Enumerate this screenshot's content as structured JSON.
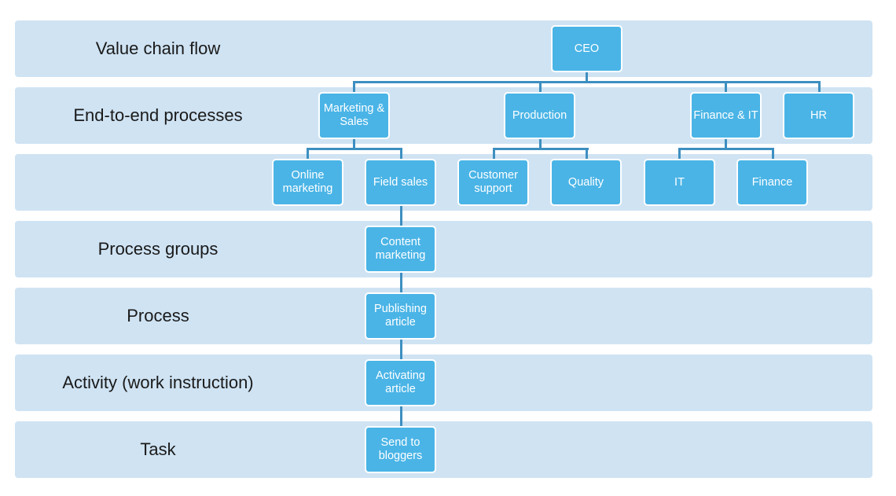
{
  "bands": [
    {
      "label": "Value chain flow"
    },
    {
      "label": "End-to-end processes"
    },
    {
      "label": ""
    },
    {
      "label": "Process groups"
    },
    {
      "label": "Process"
    },
    {
      "label": "Activity (work instruction)"
    },
    {
      "label": "Task"
    }
  ],
  "nodes": {
    "ceo": "CEO",
    "marketing_sales": "Marketing & Sales",
    "production": "Production",
    "finance_it": "Finance & IT",
    "hr": "HR",
    "online_marketing": "Online marketing",
    "field_sales": "Field sales",
    "customer_support": "Customer support",
    "quality": "Quality",
    "it": "IT",
    "finance": "Finance",
    "content_marketing": "Content marketing",
    "publishing_article": "Publishing article",
    "activating_article": "Activating article",
    "send_to_bloggers": "Send to bloggers"
  },
  "colors": {
    "band": "#cfe3f3",
    "node": "#4ab4e6",
    "connector": "#3d8fc0"
  }
}
